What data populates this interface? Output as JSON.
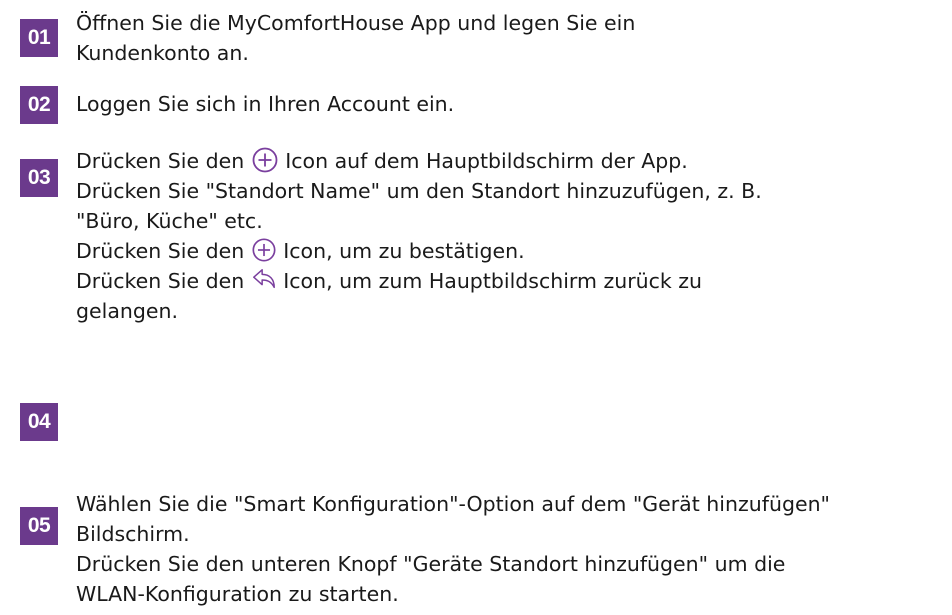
{
  "steps": [
    {
      "number": "01",
      "lines": [
        "Öffnen Sie die MyComfortHouse App und legen Sie ein",
        "Kundenkonto an."
      ]
    },
    {
      "number": "02",
      "lines": [
        "Loggen Sie sich in Ihren Account ein."
      ]
    },
    {
      "number": "03",
      "line1_pre": "Drücken Sie den ",
      "line1_post": " Icon auf dem Hauptbildschirm der App.",
      "line2": "Drücken Sie \"Standort Name\" um den Standort hinzuzufügen, z. B.",
      "line3": "\"Büro, Küche\" etc.",
      "line4_pre": "Drücken Sie den ",
      "line4_post": " Icon, um zu bestätigen.",
      "line5_pre": "Drücken Sie den ",
      "line5_post": " Icon, um zum Hauptbildschirm zurück zu",
      "line6": "gelangen."
    },
    {
      "number": "04",
      "lines": []
    },
    {
      "number": "05",
      "lines": [
        "Wählen Sie die \"Smart Konfiguration\"-Option auf dem \"Gerät hinzufügen\"",
        "Bildschirm.",
        "Drücken Sie den unteren Knopf \"Geräte Standort hinzufügen\" um die",
        "WLAN-Konfiguration zu starten."
      ]
    }
  ],
  "icons": {
    "add": "plus-circle-icon",
    "back": "back-arrow-icon"
  },
  "colors": {
    "badge": "#6b3a8c",
    "icon": "#7a3f9e",
    "text": "#1a1a1a"
  }
}
